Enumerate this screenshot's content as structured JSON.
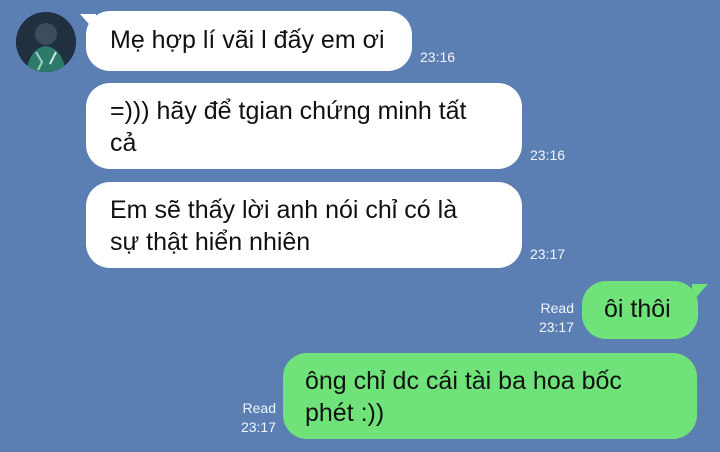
{
  "chat": {
    "messages": [
      {
        "direction": "in",
        "text": "Mẹ hợp lí vãi l đấy em ơi",
        "time": "23:16"
      },
      {
        "direction": "in",
        "text": "=))) hãy để tgian chứng minh tất cả",
        "line1": "=))) hãy để tgian chứng minh tất",
        "line2": "cả",
        "time": "23:16"
      },
      {
        "direction": "in",
        "text": "Em sẽ thấy lời anh nói chỉ có là sự thật hiển nhiên",
        "line1": "Em sẽ thấy lời anh nói chỉ có là",
        "line2": "sự thật hiển nhiên",
        "time": "23:17"
      },
      {
        "direction": "out",
        "text": "ôi thôi",
        "status": "Read",
        "time": "23:17"
      },
      {
        "direction": "out",
        "text": "ông chỉ dc cái tài ba hoa bốc phét :))",
        "line1": "ông chỉ dc cái tài ba hoa bốc",
        "line2": "phét :))",
        "status": "Read",
        "time": "23:17"
      }
    ]
  },
  "colors": {
    "background": "#5b7fb3",
    "incoming": "#ffffff",
    "outgoing": "#6fe37a"
  },
  "icons": {
    "avatar": "contact-avatar"
  }
}
